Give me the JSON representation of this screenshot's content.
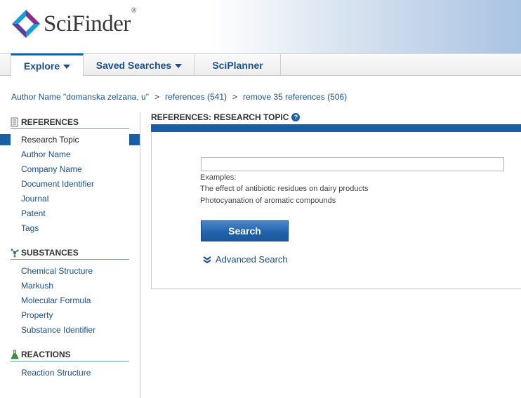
{
  "brand": {
    "name": "SciFinder",
    "mark": "®"
  },
  "tabs": [
    {
      "label": "Explore",
      "dropdown": true
    },
    {
      "label": "Saved Searches",
      "dropdown": true
    },
    {
      "label": "SciPlanner",
      "dropdown": false
    }
  ],
  "breadcrumb": [
    "Author Name \"domanska zelzana, u\"",
    "references (541)",
    "remove 35 references (506)"
  ],
  "breadcrumb_separator": ">",
  "sidebar": {
    "references": {
      "title": "REFERENCES",
      "items": [
        "Research Topic",
        "Author Name",
        "Company Name",
        "Document Identifier",
        "Journal",
        "Patent",
        "Tags"
      ]
    },
    "substances": {
      "title": "SUBSTANCES",
      "items": [
        "Chemical Structure",
        "Markush",
        "Molecular Formula",
        "Property",
        "Substance Identifier"
      ]
    },
    "reactions": {
      "title": "REACTIONS",
      "items": [
        "Reaction Structure"
      ]
    }
  },
  "main": {
    "title": "REFERENCES: RESEARCH TOPIC",
    "help_glyph": "?",
    "query_value": "",
    "examples_label": "Examples:",
    "examples": [
      "The effect of antibiotic residues on dairy products",
      "Photocyanation of aromatic compounds"
    ],
    "search_label": "Search",
    "advanced_label": "Advanced Search"
  },
  "colors": {
    "accent": "#1b5ea8",
    "link": "#1a4f8b"
  }
}
